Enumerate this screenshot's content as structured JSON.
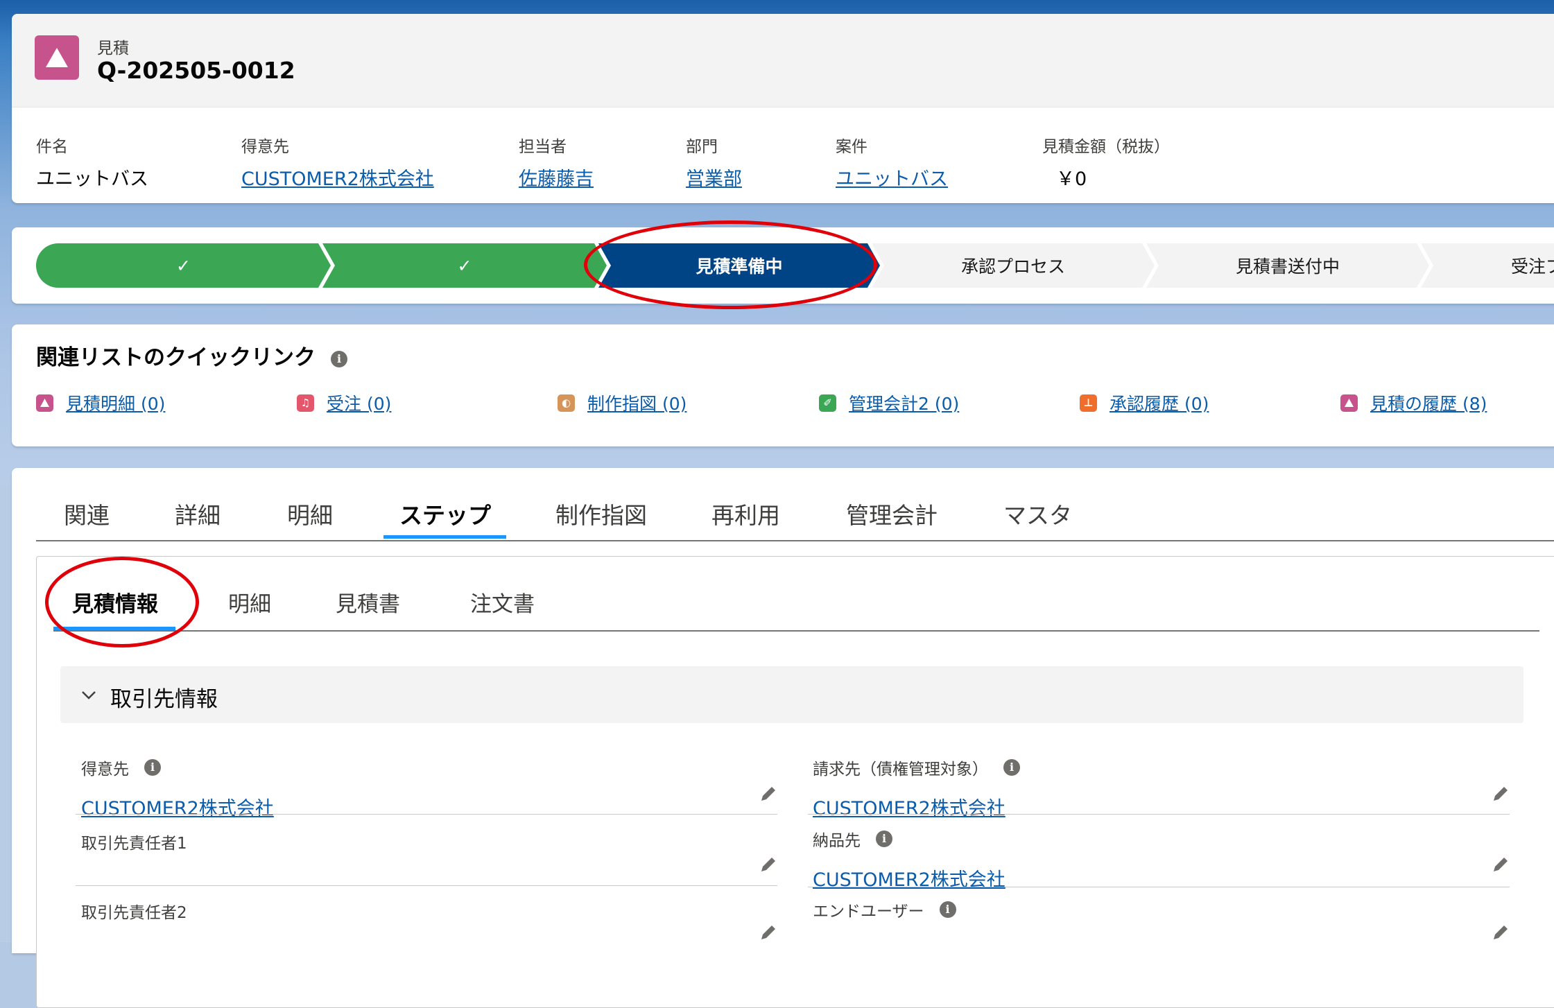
{
  "header": {
    "object_label": "見積",
    "record_name": "Q-202505-0012",
    "fields": [
      {
        "label": "件名",
        "value": "ユニットバス",
        "link": false
      },
      {
        "label": "得意先",
        "value": "CUSTOMER2株式会社",
        "link": true
      },
      {
        "label": "担当者",
        "value": "佐藤藤吉",
        "link": true
      },
      {
        "label": "部門",
        "value": "営業部",
        "link": true
      },
      {
        "label": "案件",
        "value": "ユニットバス",
        "link": true
      },
      {
        "label": "見積金額（税抜）",
        "value": "￥0",
        "link": false
      }
    ]
  },
  "path": {
    "steps": [
      {
        "label": "✓",
        "state": "complete"
      },
      {
        "label": "✓",
        "state": "complete"
      },
      {
        "label": "見積準備中",
        "state": "current"
      },
      {
        "label": "承認プロセス",
        "state": "incomplete"
      },
      {
        "label": "見積書送付中",
        "state": "incomplete"
      },
      {
        "label": "受注プ",
        "state": "incomplete"
      }
    ]
  },
  "quick_links": {
    "title": "関連リストのクイックリンク",
    "items": [
      {
        "label": "見積明細 (0)",
        "icon": "quote-icon",
        "color": "#c6538c"
      },
      {
        "label": "受注 (0)",
        "icon": "order-icon",
        "color": "#e3566b"
      },
      {
        "label": "制作指図 (0)",
        "icon": "production-icon",
        "color": "#d4945a"
      },
      {
        "label": "管理会計2 (0)",
        "icon": "accounting-icon",
        "color": "#3ba755"
      },
      {
        "label": "承認履歴 (0)",
        "icon": "approval-icon",
        "color": "#ef6e2c"
      },
      {
        "label": "見積の履歴 (8)",
        "icon": "history-icon",
        "color": "#c6538c"
      }
    ]
  },
  "tabs": {
    "items": [
      "関連",
      "詳細",
      "明細",
      "ステップ",
      "制作指図",
      "再利用",
      "管理会計",
      "マスタ"
    ],
    "active": "ステップ"
  },
  "subtabs": {
    "items": [
      "見積情報",
      "明細",
      "見積書",
      "注文書"
    ],
    "active": "見積情報"
  },
  "section": {
    "title": "取引先情報",
    "left_fields": [
      {
        "label": "得意先",
        "value": "CUSTOMER2株式会社",
        "info": true
      },
      {
        "label": "取引先責任者1",
        "value": "",
        "info": false
      },
      {
        "label": "取引先責任者2",
        "value": "",
        "info": false
      }
    ],
    "right_fields": [
      {
        "label": "請求先（債権管理対象）",
        "value": "CUSTOMER2株式会社",
        "info": true
      },
      {
        "label": "納品先",
        "value": "CUSTOMER2株式会社",
        "info": true
      },
      {
        "label": "エンドユーザー",
        "value": "",
        "info": true
      }
    ]
  },
  "colors": {
    "path_complete": "#3ba755",
    "path_current": "#014486",
    "link": "#0b5cab",
    "highlight_oval": "#e0000a",
    "tab_underline": "#1b96ff"
  }
}
